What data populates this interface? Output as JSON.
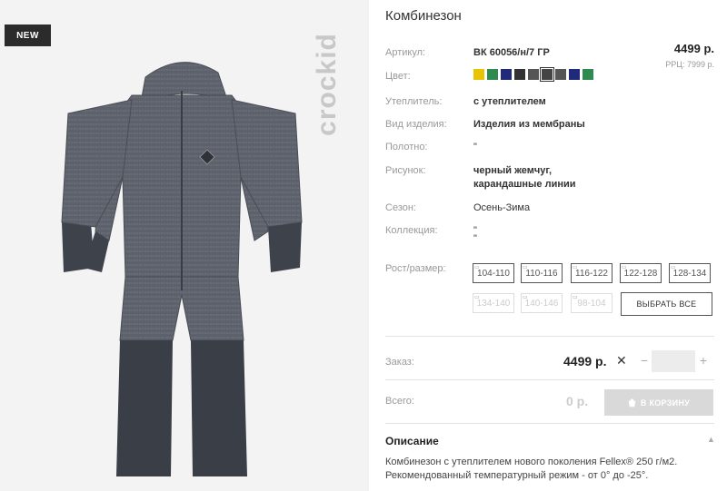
{
  "badge": "NEW",
  "brand": "crockid",
  "product": {
    "title": "Комбинезон",
    "price": "4499 р.",
    "rrp": "РРЦ: 7999 р."
  },
  "specs": {
    "article_label": "Артикул:",
    "article_value": "ВК 60056/н/7 ГР",
    "color_label": "Цвет:",
    "colors": [
      "#e8c300",
      "#2e8a4e",
      "#1f2a7a",
      "#333333",
      "#555555",
      "#444444",
      "#555555",
      "#1f2a7a",
      "#2e8a4e"
    ],
    "selected_color_index": 5,
    "insulation_label": "Утеплитель:",
    "insulation_value": "с утеплителем",
    "kind_label": "Вид изделия:",
    "kind_value": "Изделия из мембраны",
    "fabric_label": "Полотно:",
    "fabric_value": "\"",
    "pattern_label": "Рисунок:",
    "pattern_value_1": "черный жемчуг,",
    "pattern_value_2": "карандашные линии",
    "season_label": "Сезон:",
    "season_value": "Осень-Зима",
    "collection_label": "Коллекция:",
    "collection_value_1": "\"",
    "collection_value_2": "\""
  },
  "sizes": {
    "label": "Рост/размер:",
    "available": [
      "104-110",
      "110-116",
      "116-122",
      "122-128",
      "128-134"
    ],
    "disabled": [
      "134-140",
      "140-146",
      "98-104"
    ],
    "select_all": "ВЫБРАТЬ ВСЕ"
  },
  "order": {
    "label": "Заказ:",
    "price": "4499 р.",
    "times": "✕",
    "minus": "−",
    "qty": "",
    "plus": "+"
  },
  "total": {
    "label": "Всего:",
    "value": "0 р.",
    "cart_button": "В КОРЗИНУ"
  },
  "description": {
    "title": "Описание",
    "line_1": "Комбинезон с утеплителем нового поколения Fellex® 250 г/м2.",
    "line_2": "Рекомендованный температурный режим - от 0° до -25°."
  }
}
